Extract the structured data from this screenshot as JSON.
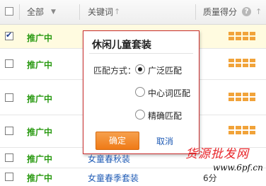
{
  "header": {
    "all_label": "全部",
    "keyword_label": "关键词",
    "quality_label": "质量得分"
  },
  "rows": [
    {
      "status": "推广中",
      "keyword": "",
      "score": "",
      "checked": true
    },
    {
      "status": "推广中",
      "keyword": "",
      "score": ""
    },
    {
      "status": "推广中",
      "keyword": "",
      "score": ""
    },
    {
      "status": "推广中",
      "keyword": "",
      "score": ""
    },
    {
      "status": "推广中",
      "keyword": "女童春秋装",
      "score": ""
    },
    {
      "status": "推广中",
      "keyword": "女童春季套装",
      "score": "6分"
    }
  ],
  "popup": {
    "title": "休闲儿童套装",
    "match_label": "匹配方式：",
    "options": [
      "广泛匹配",
      "中心词匹配",
      "精确匹配"
    ],
    "selected_option": "广泛匹配",
    "ok_label": "确定",
    "cancel_label": "取消"
  },
  "watermark": {
    "text": "货源批发网",
    "url": "www.6pf.cn"
  },
  "colors": {
    "status_green": "#2a9a12",
    "link_blue": "#1f5bb5",
    "popup_border": "#c92c2c",
    "ok_button": "#ef7a16",
    "quality_bar": "#f1a33a"
  },
  "icons": [
    "checkbox",
    "dropdown-arrow-icon",
    "sort-arrow-icon",
    "help-icon",
    "quality-bars-icon"
  ]
}
